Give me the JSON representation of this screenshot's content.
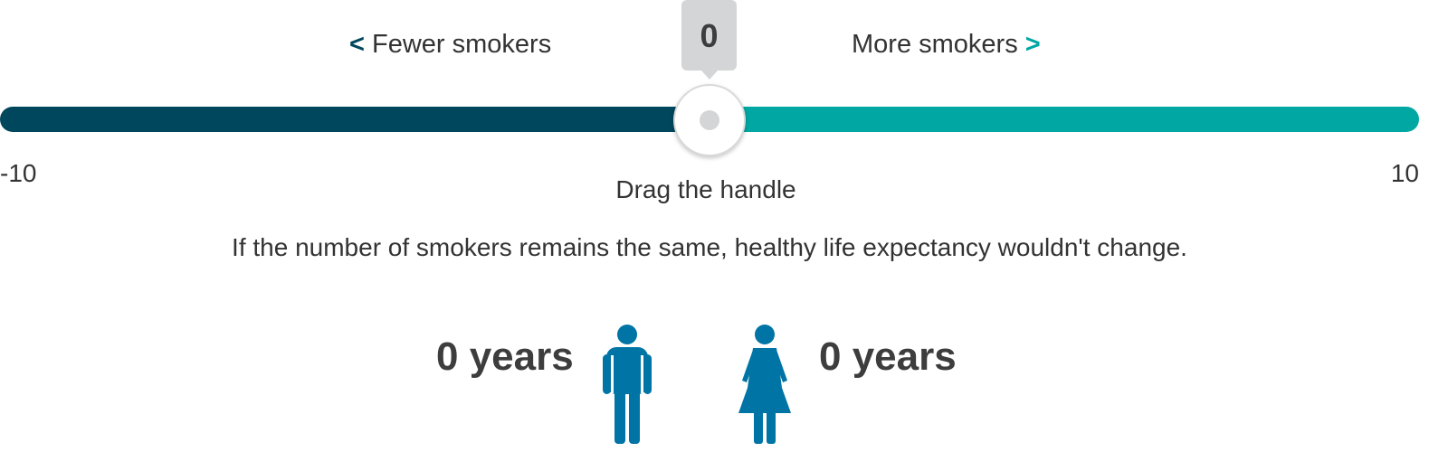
{
  "slider": {
    "min_label": "-10",
    "max_label": "10",
    "min": -10,
    "max": 10,
    "value": 0,
    "value_label": "0",
    "left_label": "Fewer smokers",
    "right_label": "More smokers",
    "left_chevron": "<",
    "right_chevron": ">",
    "hint": "Drag the handle"
  },
  "message": "If the number of smokers remains the same, healthy life expectancy wouldn't change.",
  "results": {
    "male": {
      "value": "0 years",
      "icon": "man-icon"
    },
    "female": {
      "value": "0 years",
      "icon": "woman-icon"
    }
  },
  "colors": {
    "track_left": "#00465c",
    "track_right": "#00a7a3",
    "person_icon": "#0074a5",
    "tooltip_bg": "#d4d5d7"
  }
}
